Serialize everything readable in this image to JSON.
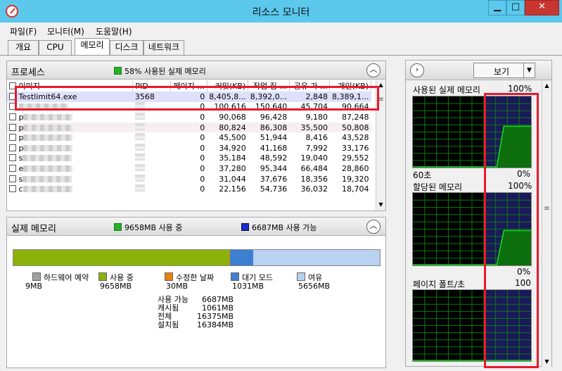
{
  "window": {
    "title": "리소스 모니터"
  },
  "menu": [
    "파일(F)",
    "모니터(M)",
    "도움말(H)"
  ],
  "tabs": [
    "개요",
    "CPU",
    "메모리",
    "디스크",
    "네트워크"
  ],
  "process_panel": {
    "title": "프로세스",
    "status": "58% 사용된 실제 메모리",
    "columns": [
      "이미지",
      "PID",
      "페이지 ...",
      "커밋(KB)",
      "작업 집 ...",
      "공유 가 ...",
      "개인(KB)"
    ],
    "rows": [
      {
        "image": "Testlimit64.exe",
        "pid": "3568",
        "hard_faults": "0",
        "commit": "8,405,8...",
        "working_set": "8,392,0...",
        "shareable": "2,848",
        "private": "8,389,1..."
      },
      {
        "image": "",
        "pid": "",
        "hard_faults": "0",
        "commit": "100,616",
        "working_set": "150,640",
        "shareable": "45,704",
        "private": "90,664"
      },
      {
        "image": "p",
        "pid": "",
        "hard_faults": "0",
        "commit": "90,068",
        "working_set": "96,428",
        "shareable": "9,180",
        "private": "87,248"
      },
      {
        "image": "p",
        "pid": "",
        "hard_faults": "0",
        "commit": "80,824",
        "working_set": "86,308",
        "shareable": "35,500",
        "private": "50,808"
      },
      {
        "image": "p",
        "pid": "",
        "hard_faults": "0",
        "commit": "45,500",
        "working_set": "51,944",
        "shareable": "8,416",
        "private": "43,528"
      },
      {
        "image": "p",
        "pid": "",
        "hard_faults": "0",
        "commit": "34,920",
        "working_set": "41,168",
        "shareable": "7,992",
        "private": "33,176"
      },
      {
        "image": "s",
        "pid": "",
        "hard_faults": "0",
        "commit": "35,184",
        "working_set": "48,592",
        "shareable": "19,040",
        "private": "29,552"
      },
      {
        "image": "e",
        "pid": "",
        "hard_faults": "0",
        "commit": "37,280",
        "working_set": "95,344",
        "shareable": "66,484",
        "private": "28,860"
      },
      {
        "image": "s",
        "pid": "",
        "hard_faults": "0",
        "commit": "31,044",
        "working_set": "37,676",
        "shareable": "18,356",
        "private": "19,320"
      },
      {
        "image": "c",
        "pid": "",
        "hard_faults": "0",
        "commit": "22,156",
        "working_set": "54,736",
        "shareable": "36,032",
        "private": "18,704"
      }
    ]
  },
  "physical_memory": {
    "title": "실제 메모리",
    "in_use_header": "9658MB 사용 중",
    "available_header": "6687MB 사용 가능",
    "bar_fractions": {
      "hardware_reserved": 0.0005,
      "in_use": 0.5895,
      "modified": 0.0018,
      "standby": 0.063,
      "free": 0.3452
    },
    "legend": [
      {
        "label": "하드웨어 예약",
        "value": "9MB",
        "color": "#a0a0a0"
      },
      {
        "label": "사용 중",
        "value": "9658MB",
        "color": "#8db10b"
      },
      {
        "label": "수정한 날짜",
        "value": "30MB",
        "color": "#e8820c"
      },
      {
        "label": "대기 모드",
        "value": "1031MB",
        "color": "#3d7fd0"
      },
      {
        "label": "여유",
        "value": "5656MB",
        "color": "#b8d2f0"
      }
    ],
    "stats": [
      {
        "key": "사용 가능",
        "value": "6687MB"
      },
      {
        "key": "캐시됨",
        "value": "1061MB"
      },
      {
        "key": "전체",
        "value": "16375MB"
      },
      {
        "key": "설치됨",
        "value": "16384MB"
      }
    ]
  },
  "right_panel": {
    "view_label": "보기",
    "graphs": [
      {
        "title": "사용된 실제 메모리",
        "top_pct": "100%",
        "bottom_left": "60초",
        "bottom_right": "0%"
      },
      {
        "title": "할당된 메모리",
        "top_pct": "100%",
        "bottom_right": "0%"
      },
      {
        "title": "페이지 폴트/초",
        "top_pct": "100"
      }
    ]
  },
  "colors": {
    "selected_row": "#dfe0fb",
    "graph_line": "#17e117",
    "graph_grid": "#0a7a0a",
    "highlight": "#e8192c",
    "graph_shade": "#1a1a5a"
  }
}
